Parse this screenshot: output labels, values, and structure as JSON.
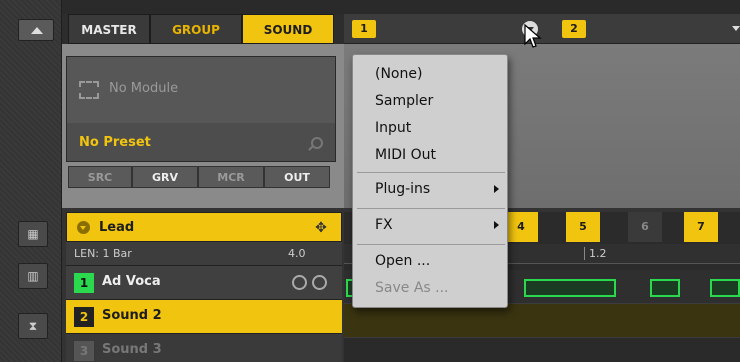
{
  "tabs": {
    "master": "MASTER",
    "group": "GROUP",
    "sound": "SOUND"
  },
  "slots": {
    "slot1": "1",
    "slot2": "2"
  },
  "module": {
    "empty_label": "No Module",
    "preset_label": "No Preset",
    "pages": [
      "SRC",
      "GRV",
      "MCR",
      "OUT"
    ]
  },
  "group_header": {
    "name": "Lead"
  },
  "length": {
    "label": "LEN: 1 Bar",
    "value": "4.0"
  },
  "sounds": [
    {
      "num": "1",
      "name": "Ad Voca"
    },
    {
      "num": "2",
      "name": "Sound 2"
    },
    {
      "num": "3",
      "name": "Sound 3"
    }
  ],
  "pattern": {
    "bars": [
      "4",
      "5",
      "6",
      "7"
    ],
    "ruler_label": "1.2"
  },
  "menu": {
    "items": [
      "(None)",
      "Sampler",
      "Input",
      "MIDI Out",
      "Plug-ins",
      "FX",
      "Open ...",
      "Save As ..."
    ]
  },
  "colors": {
    "accent": "#f1c40f",
    "note": "#2bd94f",
    "menu_bg": "#cfcfcf"
  }
}
